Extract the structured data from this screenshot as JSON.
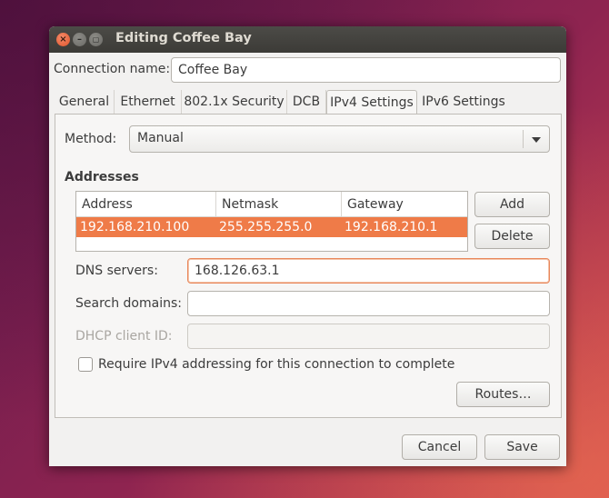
{
  "window": {
    "title": "Editing Coffee Bay",
    "close_glyph": "×",
    "min_glyph": "–",
    "max_glyph": "▢"
  },
  "connection": {
    "label": "Connection name:",
    "value": "Coffee Bay"
  },
  "tabs": [
    {
      "label": "General",
      "active": false
    },
    {
      "label": "Ethernet",
      "active": false
    },
    {
      "label": "802.1x Security",
      "active": false
    },
    {
      "label": "DCB",
      "active": false
    },
    {
      "label": "IPv4 Settings",
      "active": true
    },
    {
      "label": "IPv6 Settings",
      "active": false
    }
  ],
  "method": {
    "label": "Method:",
    "value": "Manual"
  },
  "addresses": {
    "heading": "Addresses",
    "columns": [
      "Address",
      "Netmask",
      "Gateway"
    ],
    "rows": [
      [
        "192.168.210.100",
        "255.255.255.0",
        "192.168.210.1"
      ]
    ],
    "add_label": "Add",
    "delete_label": "Delete"
  },
  "dns": {
    "label": "DNS servers:",
    "value": "168.126.63.1"
  },
  "search_domains": {
    "label": "Search domains:",
    "value": ""
  },
  "dhcp_client_id": {
    "label": "DHCP client ID:",
    "value": ""
  },
  "require_ipv4": {
    "label": "Require IPv4 addressing for this connection to complete",
    "checked": false
  },
  "routes_label": "Routes…",
  "footer": {
    "cancel_label": "Cancel",
    "save_label": "Save"
  },
  "colors": {
    "selection": "#ef7b48",
    "focus_border": "#e9875b",
    "titlebar": "#3c3b37",
    "window_bg": "#f2f1f0"
  }
}
